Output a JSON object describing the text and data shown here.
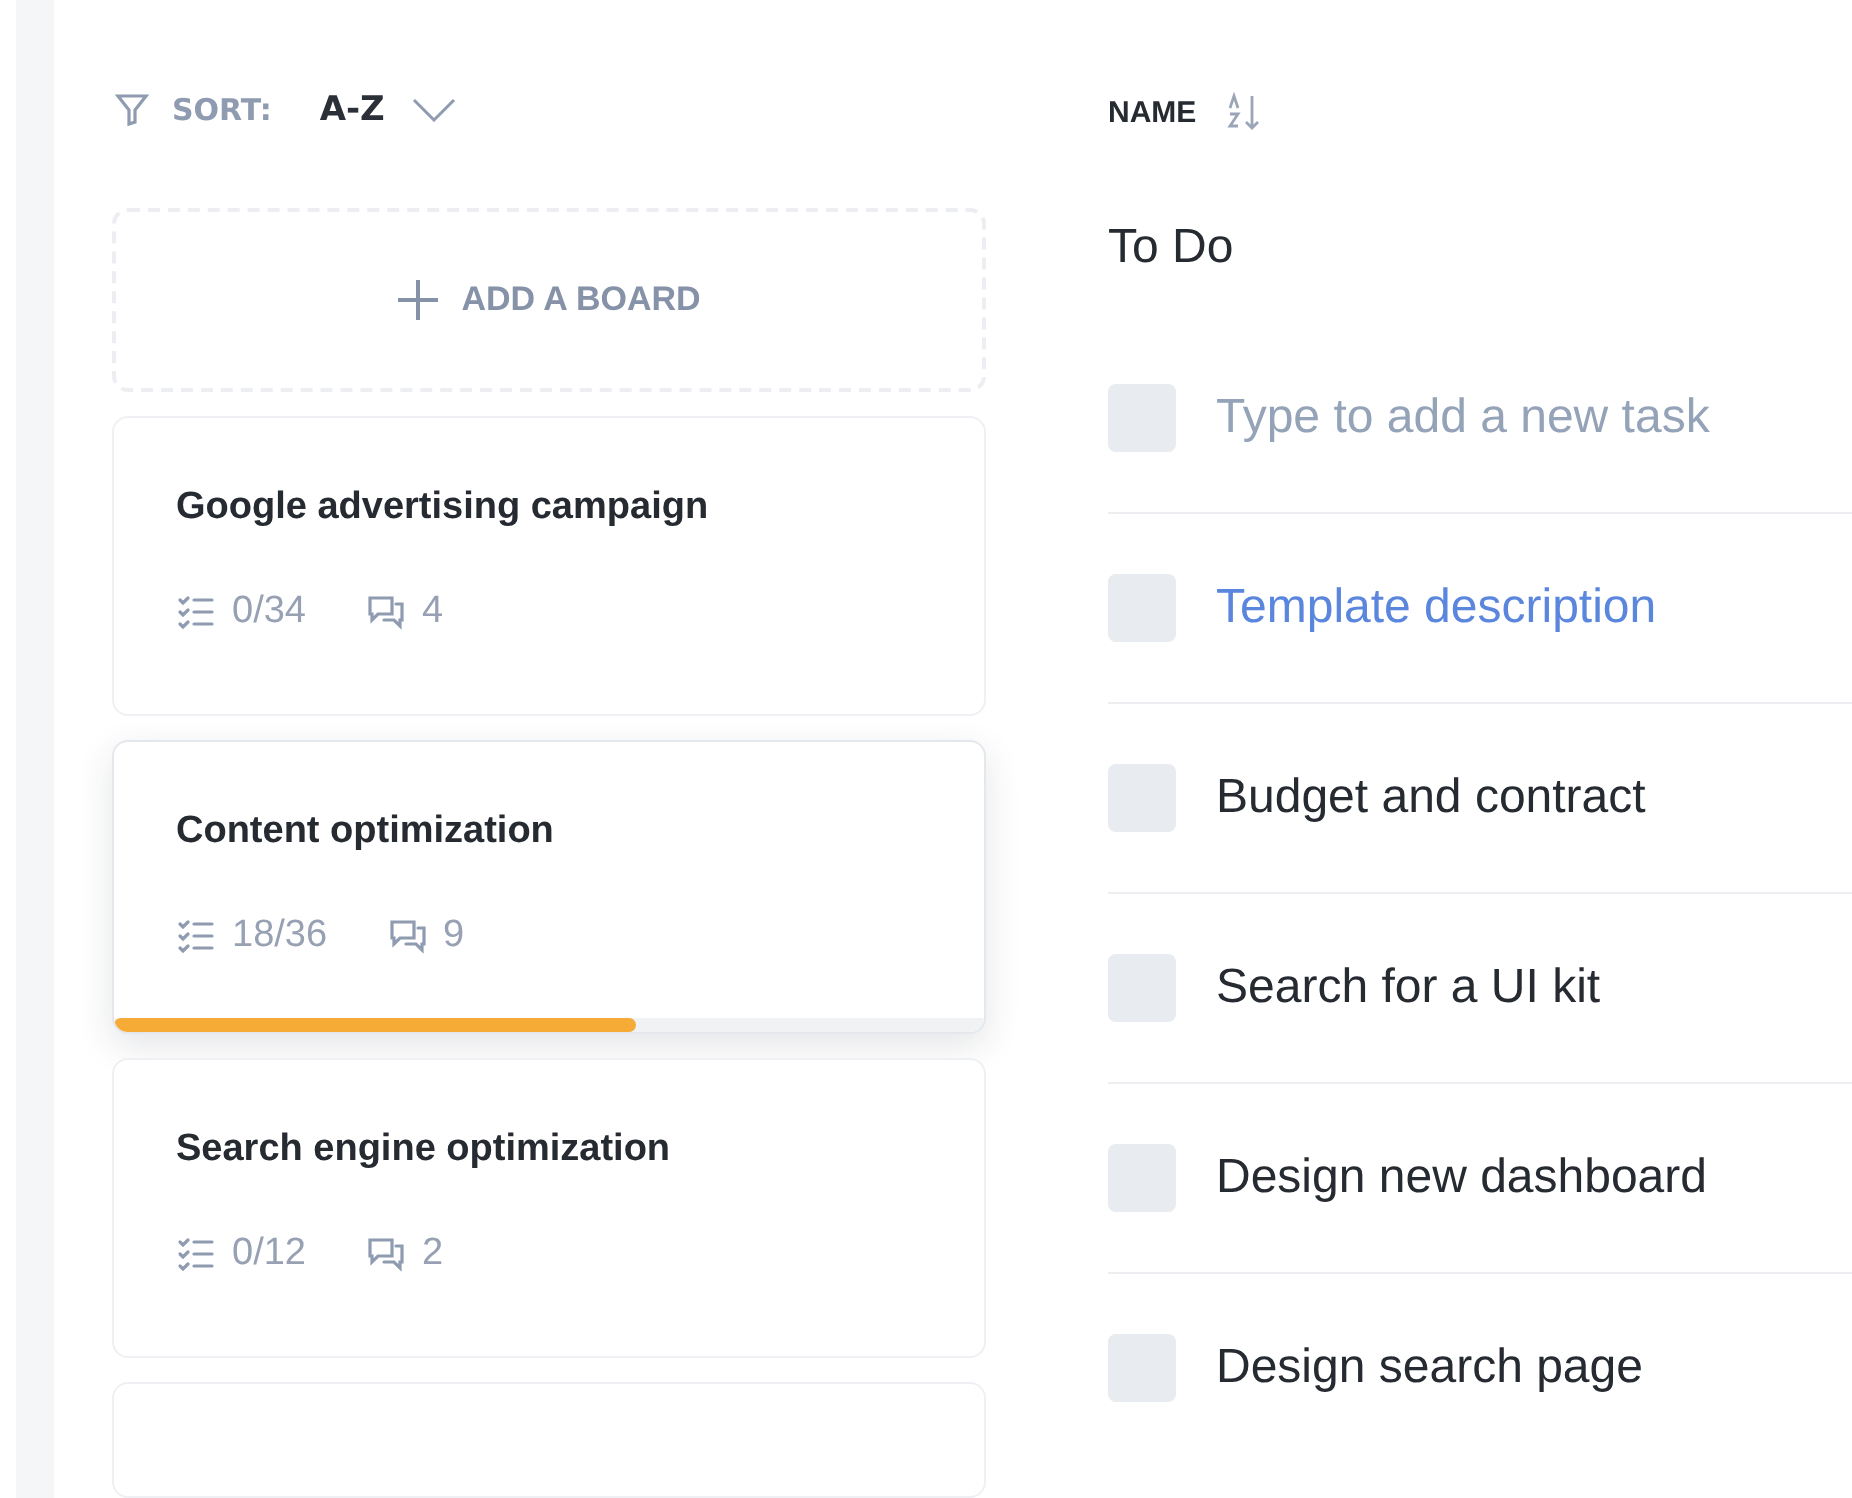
{
  "sort": {
    "label": "SORT:",
    "value": "A-Z"
  },
  "add_board": {
    "label": "ADD A BOARD"
  },
  "boards": [
    {
      "title": "Google advertising campaign",
      "tasks": "0/34",
      "comments": "4",
      "selected": false
    },
    {
      "title": "Content optimization",
      "tasks": "18/36",
      "comments": "9",
      "selected": true,
      "level": 0.6
    },
    {
      "title": "Search engine optimization",
      "tasks": "0/12",
      "comments": "2",
      "selected": false
    }
  ],
  "list": {
    "column": "NAME",
    "title": "To Do"
  },
  "tasks": [
    {
      "kind": "input",
      "placeholder": "Type to add a new task",
      "checked": false
    },
    {
      "kind": "link",
      "label": "Template description",
      "checked": false
    },
    {
      "kind": "task",
      "label": "Budget and contract",
      "checked": false
    },
    {
      "kind": "task",
      "label": "Search for a UI kit",
      "checked": false
    },
    {
      "kind": "task",
      "label": "Design new dashboard",
      "checked": false
    },
    {
      "kind": "task",
      "label": "Design search page",
      "checked": false
    }
  ]
}
